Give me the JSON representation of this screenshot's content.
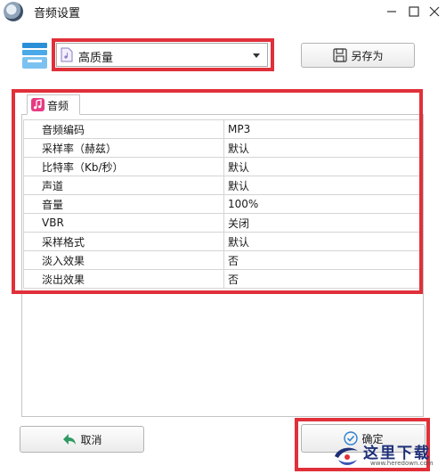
{
  "window": {
    "title": "音频设置"
  },
  "preset": {
    "selected": "高质量"
  },
  "toolbar": {
    "save_as_label": "另存为"
  },
  "tabs": [
    {
      "label": "音频",
      "icon": "music-note-icon"
    }
  ],
  "settings": [
    {
      "name": "音频编码",
      "value": "MP3"
    },
    {
      "name": "采样率（赫兹）",
      "value": "默认"
    },
    {
      "name": "比特率（Kb/秒）",
      "value": "默认"
    },
    {
      "name": "声道",
      "value": "默认"
    },
    {
      "name": "音量",
      "value": "100%"
    },
    {
      "name": "VBR",
      "value": "关闭"
    },
    {
      "name": "采样格式",
      "value": "默认"
    },
    {
      "name": "淡入效果",
      "value": "否"
    },
    {
      "name": "淡出效果",
      "value": "否"
    }
  ],
  "footer": {
    "cancel_label": "取消",
    "ok_label": "确定"
  },
  "watermark": {
    "text": "这里下载",
    "url": "www.heredown.com"
  },
  "colors": {
    "highlight": "#e0303a",
    "tab_icon": "#e83a83",
    "cancel_arrow": "#2f9a63",
    "watermark": "#1e2f77"
  }
}
